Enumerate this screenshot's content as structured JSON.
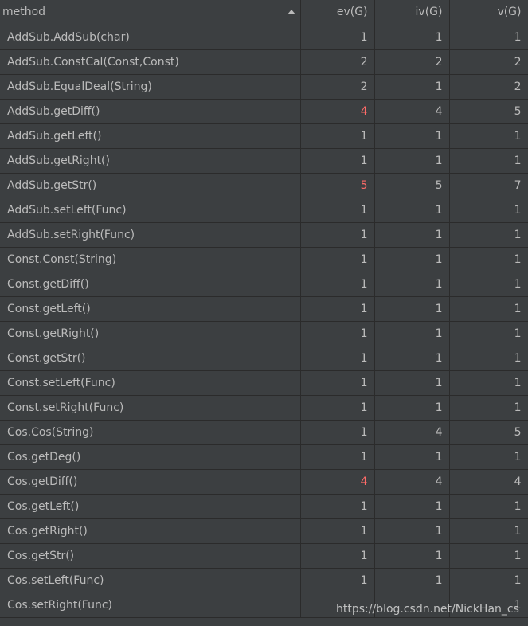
{
  "table": {
    "columns": [
      "method",
      "ev(G)",
      "iv(G)",
      "v(G)"
    ],
    "warn_color": "#ff6b68",
    "rows": [
      {
        "method": "AddSub.AddSub(char)",
        "ev": "1",
        "iv": "1",
        "v": "1",
        "warn": false
      },
      {
        "method": "AddSub.ConstCal(Const,Const)",
        "ev": "2",
        "iv": "2",
        "v": "2",
        "warn": false
      },
      {
        "method": "AddSub.EqualDeal(String)",
        "ev": "2",
        "iv": "1",
        "v": "2",
        "warn": false
      },
      {
        "method": "AddSub.getDiff()",
        "ev": "4",
        "iv": "4",
        "v": "5",
        "warn": true
      },
      {
        "method": "AddSub.getLeft()",
        "ev": "1",
        "iv": "1",
        "v": "1",
        "warn": false
      },
      {
        "method": "AddSub.getRight()",
        "ev": "1",
        "iv": "1",
        "v": "1",
        "warn": false
      },
      {
        "method": "AddSub.getStr()",
        "ev": "5",
        "iv": "5",
        "v": "7",
        "warn": true
      },
      {
        "method": "AddSub.setLeft(Func)",
        "ev": "1",
        "iv": "1",
        "v": "1",
        "warn": false
      },
      {
        "method": "AddSub.setRight(Func)",
        "ev": "1",
        "iv": "1",
        "v": "1",
        "warn": false
      },
      {
        "method": "Const.Const(String)",
        "ev": "1",
        "iv": "1",
        "v": "1",
        "warn": false
      },
      {
        "method": "Const.getDiff()",
        "ev": "1",
        "iv": "1",
        "v": "1",
        "warn": false
      },
      {
        "method": "Const.getLeft()",
        "ev": "1",
        "iv": "1",
        "v": "1",
        "warn": false
      },
      {
        "method": "Const.getRight()",
        "ev": "1",
        "iv": "1",
        "v": "1",
        "warn": false
      },
      {
        "method": "Const.getStr()",
        "ev": "1",
        "iv": "1",
        "v": "1",
        "warn": false
      },
      {
        "method": "Const.setLeft(Func)",
        "ev": "1",
        "iv": "1",
        "v": "1",
        "warn": false
      },
      {
        "method": "Const.setRight(Func)",
        "ev": "1",
        "iv": "1",
        "v": "1",
        "warn": false
      },
      {
        "method": "Cos.Cos(String)",
        "ev": "1",
        "iv": "4",
        "v": "5",
        "warn": false
      },
      {
        "method": "Cos.getDeg()",
        "ev": "1",
        "iv": "1",
        "v": "1",
        "warn": false
      },
      {
        "method": "Cos.getDiff()",
        "ev": "4",
        "iv": "4",
        "v": "4",
        "warn": true
      },
      {
        "method": "Cos.getLeft()",
        "ev": "1",
        "iv": "1",
        "v": "1",
        "warn": false
      },
      {
        "method": "Cos.getRight()",
        "ev": "1",
        "iv": "1",
        "v": "1",
        "warn": false
      },
      {
        "method": "Cos.getStr()",
        "ev": "1",
        "iv": "1",
        "v": "1",
        "warn": false
      },
      {
        "method": "Cos.setLeft(Func)",
        "ev": "1",
        "iv": "1",
        "v": "1",
        "warn": false
      },
      {
        "method": "Cos.setRight(Func)",
        "ev": "",
        "iv": "",
        "v": "1",
        "warn": false
      }
    ]
  },
  "watermark": "https://blog.csdn.net/NickHan_cs"
}
